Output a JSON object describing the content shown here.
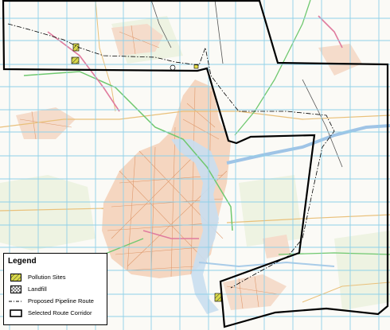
{
  "legend": {
    "title": "Legend",
    "items": [
      {
        "label": "Pollution Sites",
        "symbol": "pollution-sites-hatched-icon",
        "color": "#c8c832"
      },
      {
        "label": "Landfill",
        "symbol": "landfill-crosshatch-icon",
        "color": "#666666"
      },
      {
        "label": "Proposed Pipeline Route",
        "symbol": "dash-dot-line-icon",
        "color": "#000000"
      },
      {
        "label": "Selected Route Corridor",
        "symbol": "hollow-rectangle-icon",
        "color": "#000000"
      }
    ]
  },
  "colors": {
    "grid": "#8fd0e8",
    "water": "#c9def0",
    "urban": "#f2c6a8",
    "urbanRoad": "#d98a58",
    "motorway": "#6fc86f",
    "arterial": "#e07b9e",
    "corridor": "#000000",
    "pollution": "#c8c832"
  }
}
